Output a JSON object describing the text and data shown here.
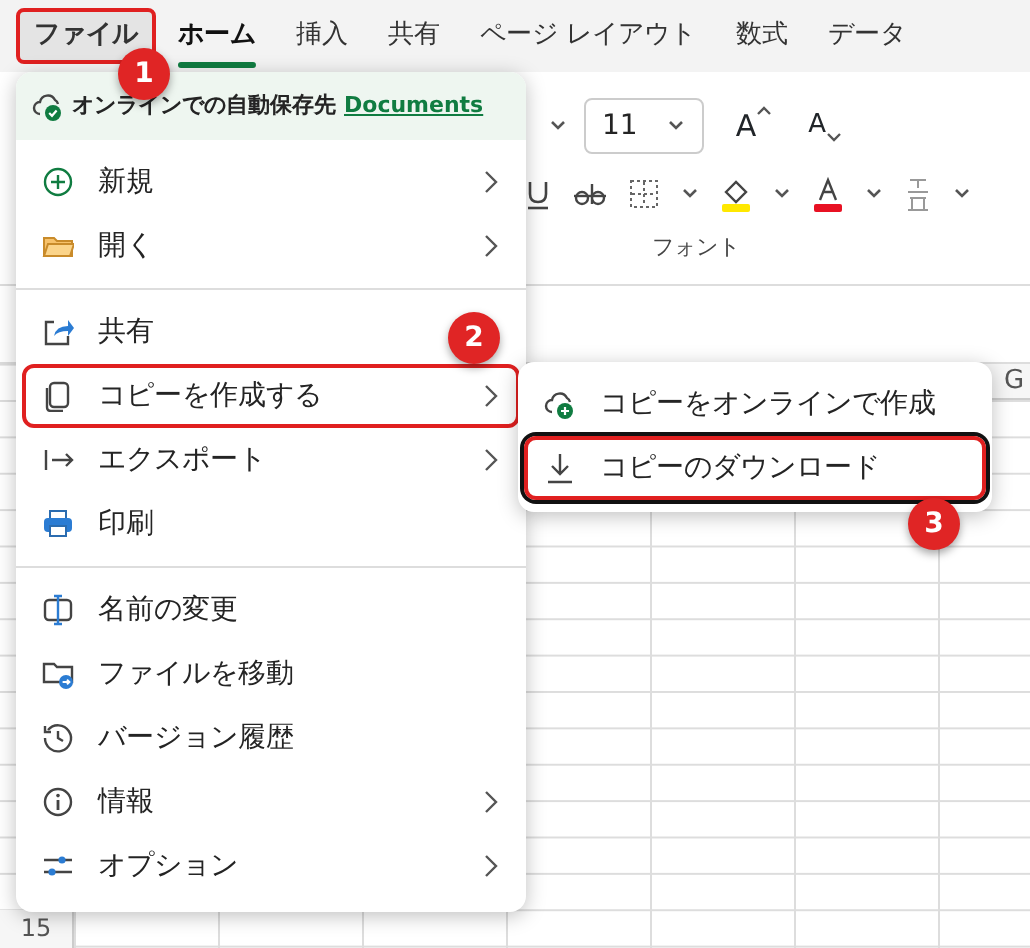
{
  "ribbon_tabs": [
    {
      "label": "ファイル",
      "selected": false,
      "highlighted": true
    },
    {
      "label": "ホーム",
      "selected": true,
      "highlighted": false
    },
    {
      "label": "挿入",
      "selected": false,
      "highlighted": false
    },
    {
      "label": "共有",
      "selected": false,
      "highlighted": false
    },
    {
      "label": "ページ レイアウト",
      "selected": false,
      "highlighted": false
    },
    {
      "label": "数式",
      "selected": false,
      "highlighted": false
    },
    {
      "label": "データ",
      "selected": false,
      "highlighted": false
    }
  ],
  "ribbon": {
    "font_size": "11",
    "grow_font": "A",
    "shrink_font": "A",
    "group_label": "フォント"
  },
  "grid": {
    "column_header": "G",
    "row_header": "15"
  },
  "file_menu": {
    "autosave": {
      "text": "オンラインでの自動保存先",
      "link": "Documents"
    },
    "groups": [
      [
        {
          "label": "新規",
          "has_submenu": true,
          "highlighted": false
        },
        {
          "label": "開く",
          "has_submenu": true,
          "highlighted": false
        }
      ],
      [
        {
          "label": "共有",
          "has_submenu": false,
          "highlighted": false
        },
        {
          "label": "コピーを作成する",
          "has_submenu": true,
          "highlighted": true
        },
        {
          "label": "エクスポート",
          "has_submenu": true,
          "highlighted": false
        },
        {
          "label": "印刷",
          "has_submenu": false,
          "highlighted": false
        }
      ],
      [
        {
          "label": "名前の変更",
          "has_submenu": false,
          "highlighted": false
        },
        {
          "label": "ファイルを移動",
          "has_submenu": false,
          "highlighted": false
        },
        {
          "label": "バージョン履歴",
          "has_submenu": false,
          "highlighted": false
        },
        {
          "label": "情報",
          "has_submenu": true,
          "highlighted": false
        },
        {
          "label": "オプション",
          "has_submenu": true,
          "highlighted": false
        }
      ]
    ]
  },
  "submenu": {
    "items": [
      {
        "label": "コピーをオンラインで作成",
        "highlighted": false,
        "focused": false
      },
      {
        "label": "コピーのダウンロード",
        "highlighted": true,
        "focused": true
      }
    ]
  },
  "callouts": [
    "1",
    "2",
    "3"
  ]
}
